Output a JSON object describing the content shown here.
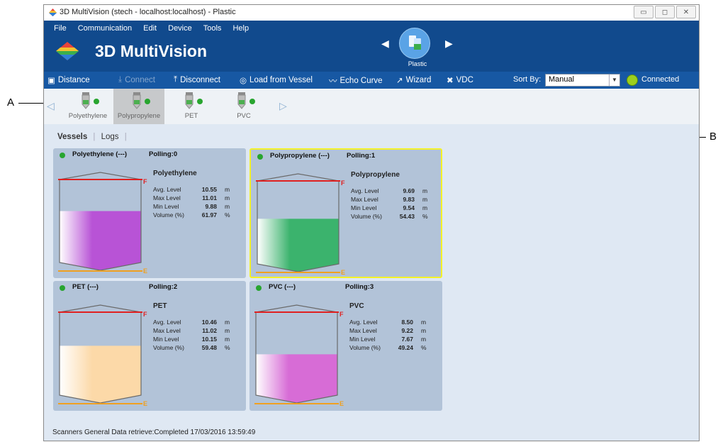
{
  "callouts": {
    "a": "A",
    "b": "B"
  },
  "window": {
    "title": "3D MultiVision (stech - localhost:localhost) - Plastic",
    "controls": {
      "minimize": "▭",
      "maximize": "◻",
      "close": "✕"
    }
  },
  "menu": [
    "File",
    "Communication",
    "Edit",
    "Device",
    "Tools",
    "Help"
  ],
  "app": {
    "title": "3D MultiVision"
  },
  "group": {
    "name": "Plastic"
  },
  "toolbar": {
    "distance": "Distance",
    "connect": "Connect",
    "disconnect": "Disconnect",
    "load_from_vessel": "Load from Vessel",
    "echo_curve": "Echo Curve",
    "wizard": "Wizard",
    "vdc": "VDC",
    "sort_by_label": "Sort By:",
    "sort_by_value": "Manual",
    "connection_status": "Connected"
  },
  "vessel_strip": [
    {
      "label": "Polyethylene"
    },
    {
      "label": "Polypropylene"
    },
    {
      "label": "PET"
    },
    {
      "label": "PVC"
    }
  ],
  "tabs": {
    "vessels": "Vessels",
    "logs": "Logs"
  },
  "colors": {
    "header": "#114a8d",
    "toolbar": "#1758a3",
    "card": "#b2c3d8",
    "selected_border": "#f4f227",
    "status_ok": "#28a52f",
    "full_line": "#e02020",
    "empty_line": "#f0a020"
  },
  "vessels": [
    {
      "header_name": "Polyethylene (---)",
      "polling": "Polling:0",
      "name": "Polyethylene",
      "avg_label": "Avg. Level",
      "avg": "10.55",
      "avg_unit": "m",
      "max_label": "Max Level",
      "max": "11.01",
      "max_unit": "m",
      "min_label": "Min Level",
      "min": "9.88",
      "min_unit": "m",
      "vol_label": "Volume (%)",
      "volume": "61.97",
      "vol_unit": "%",
      "fill_fraction": 0.62,
      "fill_color": "#b853d6"
    },
    {
      "header_name": "Polypropylene (---)",
      "polling": "Polling:1",
      "name": "Polypropylene",
      "avg_label": "Avg. Level",
      "avg": "9.69",
      "avg_unit": "m",
      "max_label": "Max Level",
      "max": "9.83",
      "max_unit": "m",
      "min_label": "Min Level",
      "min": "9.54",
      "min_unit": "m",
      "vol_label": "Volume (%)",
      "volume": "54.43",
      "vol_unit": "%",
      "fill_fraction": 0.544,
      "fill_color": "#3bb36d"
    },
    {
      "header_name": "PET (---)",
      "polling": "Polling:2",
      "name": "PET",
      "avg_label": "Avg. Level",
      "avg": "10.46",
      "avg_unit": "m",
      "max_label": "Max Level",
      "max": "11.02",
      "max_unit": "m",
      "min_label": "Min Level",
      "min": "10.15",
      "min_unit": "m",
      "vol_label": "Volume (%)",
      "volume": "59.48",
      "vol_unit": "%",
      "fill_fraction": 0.595,
      "fill_color": "#fcd9a8"
    },
    {
      "header_name": "PVC (---)",
      "polling": "Polling:3",
      "name": "PVC",
      "avg_label": "Avg. Level",
      "avg": "8.50",
      "avg_unit": "m",
      "max_label": "Max Level",
      "max": "9.22",
      "max_unit": "m",
      "min_label": "Min Level",
      "min": "7.67",
      "min_unit": "m",
      "vol_label": "Volume (%)",
      "volume": "49.24",
      "vol_unit": "%",
      "fill_fraction": 0.492,
      "fill_color": "#d76cd6"
    }
  ],
  "tank_marks": {
    "full": "F",
    "empty": "E"
  },
  "status": {
    "text": "Scanners General Data retrieve:Completed 17/03/2016 13:59:49"
  }
}
